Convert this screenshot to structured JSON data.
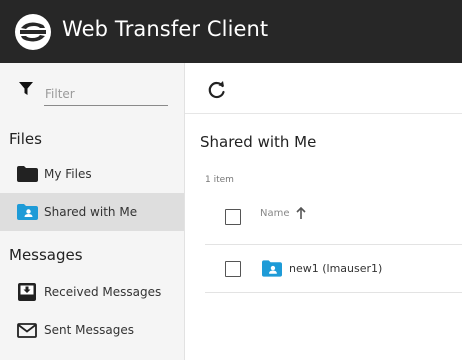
{
  "app": {
    "title": "Web Transfer Client"
  },
  "filter": {
    "placeholder": "Filter"
  },
  "sidebar": {
    "files_title": "Files",
    "files": [
      {
        "label": "My Files",
        "icon": "folder-icon"
      },
      {
        "label": "Shared with Me",
        "icon": "shared-folder-icon",
        "active": true
      }
    ],
    "messages_title": "Messages",
    "messages": [
      {
        "label": "Received Messages",
        "icon": "inbox-icon"
      },
      {
        "label": "Sent Messages",
        "icon": "envelope-icon"
      }
    ]
  },
  "main": {
    "title": "Shared with Me",
    "item_count": "1 item",
    "columns": {
      "name": "Name"
    },
    "rows": [
      {
        "name": "new1 (lmauser1)",
        "icon": "shared-folder-icon"
      }
    ]
  },
  "colors": {
    "topbar": "#272727",
    "sidebar_bg": "#f5f5f5",
    "active_bg": "#dedede",
    "shared_folder": "#1e9bd7"
  }
}
